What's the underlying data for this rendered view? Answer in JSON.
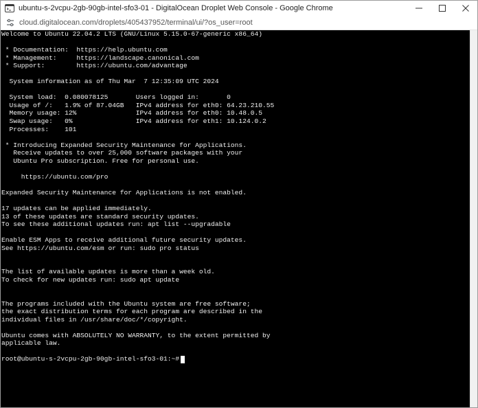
{
  "window": {
    "title": "ubuntu-s-2vcpu-2gb-90gb-intel-sfo3-01 - DigitalOcean Droplet Web Console - Google Chrome"
  },
  "browser": {
    "url": "cloud.digitalocean.com/droplets/405437952/terminal/ui/?os_user=root"
  },
  "terminal": {
    "output_lines": [
      "Welcome to Ubuntu 22.04.2 LTS (GNU/Linux 5.15.0-67-generic x86_64)",
      "",
      " * Documentation:  https://help.ubuntu.com",
      " * Management:     https://landscape.canonical.com",
      " * Support:        https://ubuntu.com/advantage",
      "",
      "  System information as of Thu Mar  7 12:35:09 UTC 2024",
      "",
      "  System load:  0.080078125       Users logged in:       0",
      "  Usage of /:   1.9% of 87.04GB   IPv4 address for eth0: 64.23.210.55",
      "  Memory usage: 12%               IPv4 address for eth0: 10.48.0.5",
      "  Swap usage:   0%                IPv4 address for eth1: 10.124.0.2",
      "  Processes:    101",
      "",
      " * Introducing Expanded Security Maintenance for Applications.",
      "   Receive updates to over 25,000 software packages with your",
      "   Ubuntu Pro subscription. Free for personal use.",
      "",
      "     https://ubuntu.com/pro",
      "",
      "Expanded Security Maintenance for Applications is not enabled.",
      "",
      "17 updates can be applied immediately.",
      "13 of these updates are standard security updates.",
      "To see these additional updates run: apt list --upgradable",
      "",
      "Enable ESM Apps to receive additional future security updates.",
      "See https://ubuntu.com/esm or run: sudo pro status",
      "",
      "",
      "The list of available updates is more than a week old.",
      "To check for new updates run: sudo apt update",
      "",
      "",
      "The programs included with the Ubuntu system are free software;",
      "the exact distribution terms for each program are described in the",
      "individual files in /usr/share/doc/*/copyright.",
      "",
      "Ubuntu comes with ABSOLUTELY NO WARRANTY, to the extent permitted by",
      "applicable law.",
      ""
    ],
    "prompt": "root@ubuntu-s-2vcpu-2gb-90gb-intel-sfo3-01:~#"
  },
  "icons": {
    "app": "terminal-app-icon",
    "minimize": "minimize-icon",
    "maximize": "maximize-icon",
    "close": "close-icon",
    "site": "site-info-icon"
  },
  "colors": {
    "terminal_background": "#000000",
    "terminal_foreground": "#f0f0f0",
    "cursor": "#ffffff"
  }
}
